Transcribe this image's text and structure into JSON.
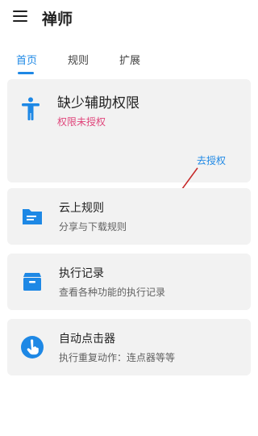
{
  "app": {
    "title": "禅师"
  },
  "tabs": [
    {
      "label": "首页",
      "active": true
    },
    {
      "label": "规则",
      "active": false
    },
    {
      "label": "扩展",
      "active": false
    }
  ],
  "permission_card": {
    "title": "缺少辅助权限",
    "status": "权限未授权",
    "action": "去授权",
    "icon": "accessibility-icon"
  },
  "features": [
    {
      "title": "云上规则",
      "subtitle": "分享与下载规则",
      "icon": "folder-icon"
    },
    {
      "title": "执行记录",
      "subtitle": "查看各种功能的执行记录",
      "icon": "archive-icon"
    },
    {
      "title": "自动点击器",
      "subtitle": "执行重复动作：连点器等等",
      "icon": "touch-icon"
    }
  ],
  "colors": {
    "accent": "#1e88e5",
    "warning": "#e0457b",
    "card": "#f2f2f2",
    "annotation_arrow": "#c62828"
  }
}
